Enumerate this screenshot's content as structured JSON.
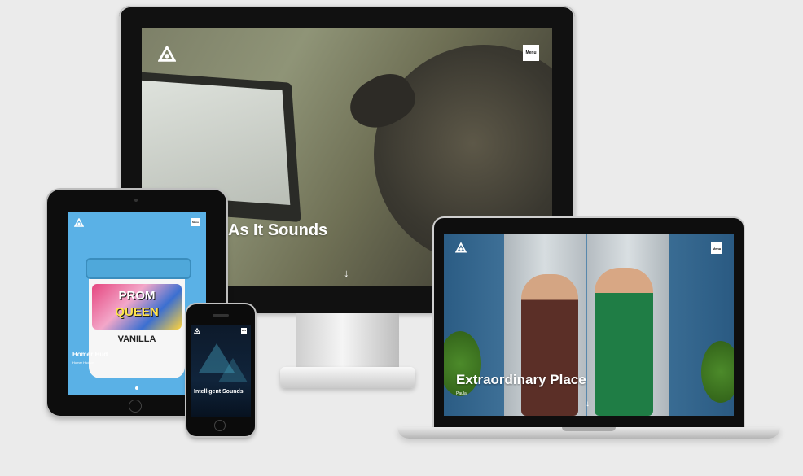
{
  "desktop": {
    "headline": "e As It Sounds",
    "menu_label": "Menu",
    "scroll_arrow": "↓",
    "logo_icon": "studio-logo-icon"
  },
  "tablet": {
    "tub_brand_line1": "PROM",
    "tub_brand_line2": "QUEEN",
    "tub_flavor": "VANILLA",
    "headline": "Homer Hud",
    "subtitle": "Homer Hudson",
    "menu_label": "Menu",
    "logo_icon": "studio-logo-icon"
  },
  "phone": {
    "headline": "Intelligent Sounds",
    "menu_label": "Menu",
    "logo_icon": "studio-logo-icon"
  },
  "laptop": {
    "headline": "Extraordinary Place",
    "subtitle": "Paula",
    "menu_label": "Menu",
    "scroll_arrow": "↓",
    "logo_icon": "studio-logo-icon"
  },
  "colors": {
    "background": "#ebebeb",
    "device_bezel": "#0e0e0e",
    "tablet_bg": "#5ab1e6",
    "laptop_bg": "#3d6f96"
  }
}
